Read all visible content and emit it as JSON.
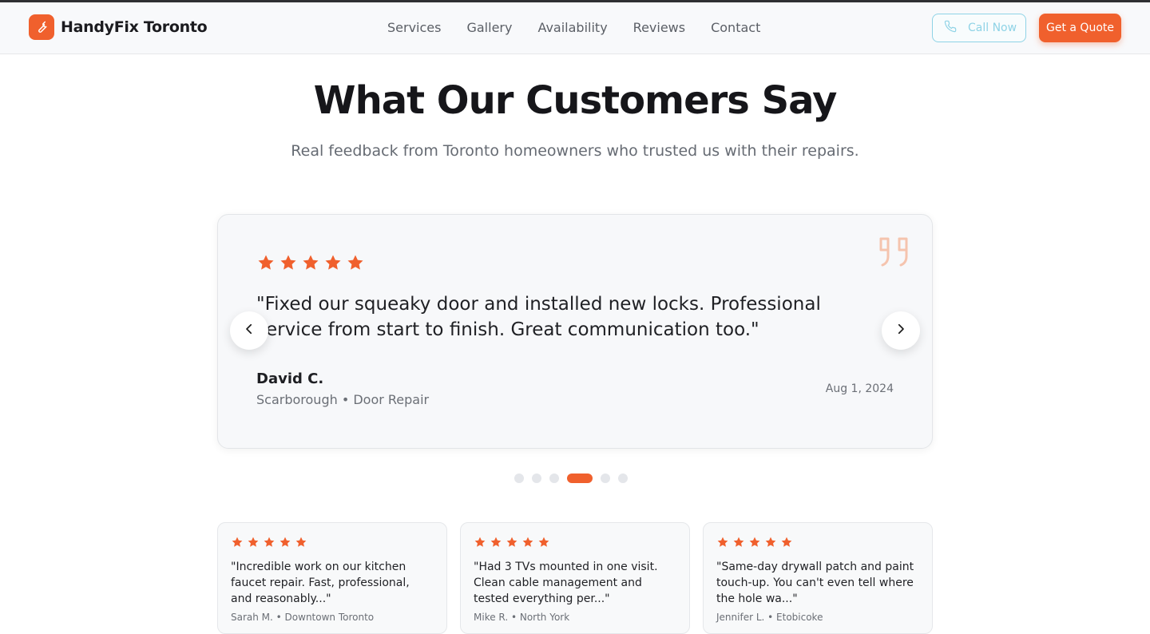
{
  "brand": {
    "name": "HandyFix Toronto",
    "icon": "wrench-icon",
    "accent": "#f0602d"
  },
  "nav": {
    "items": [
      "Services",
      "Gallery",
      "Availability",
      "Reviews",
      "Contact"
    ]
  },
  "header": {
    "call_label": "Call Now",
    "quote_label": "Get a Quote",
    "call_icon": "phone-icon"
  },
  "section": {
    "title": "What Our Customers Say",
    "subtitle": "Real feedback from Toronto homeowners who trusted us with their repairs."
  },
  "featured": {
    "rating": 5,
    "text": "\"Fixed our squeaky door and installed new locks. Professional service from start to finish. Great communication too.\"",
    "name": "David C.",
    "meta": "Scarborough • Door Repair",
    "date": "Aug 1, 2024"
  },
  "carousel": {
    "total": 6,
    "active_index": 3
  },
  "cards": [
    {
      "rating": 5,
      "text": "\"Incredible work on our kitchen faucet repair. Fast, professional, and reasonably...\"",
      "meta": "Sarah M. • Downtown Toronto"
    },
    {
      "rating": 5,
      "text": "\"Had 3 TVs mounted in one visit. Clean cable management and tested everything per...\"",
      "meta": "Mike R. • North York"
    },
    {
      "rating": 5,
      "text": "\"Same-day drywall patch and paint touch-up. You can't even tell where the hole wa...\"",
      "meta": "Jennifer L. • Etobicoke"
    }
  ]
}
